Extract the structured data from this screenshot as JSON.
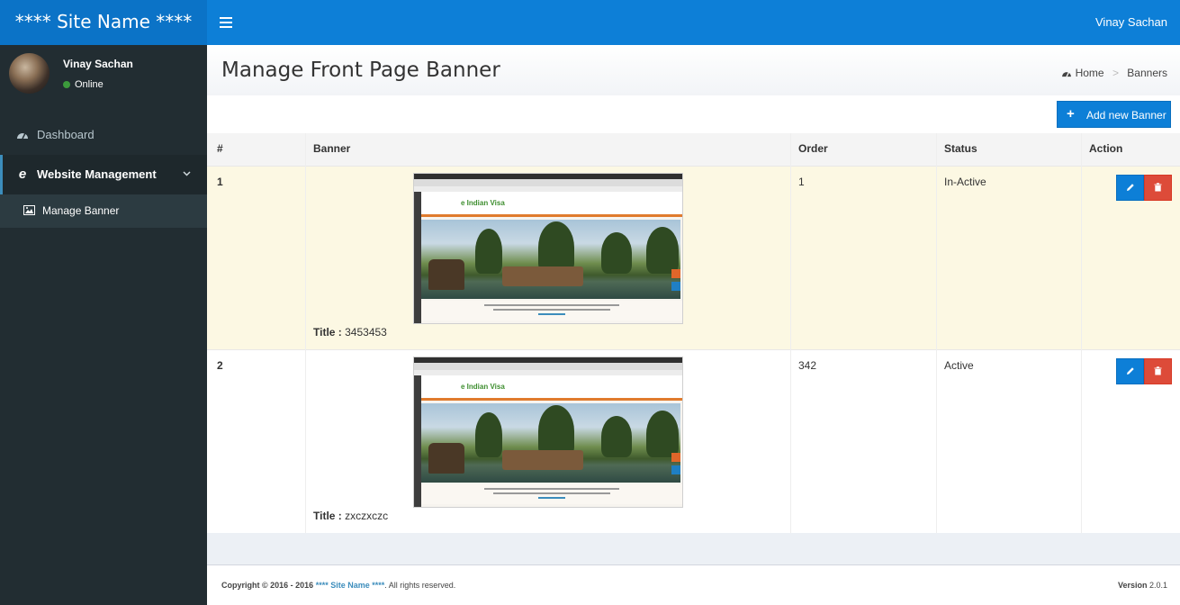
{
  "header": {
    "site_name": "**** Site Name ****",
    "user_name": "Vinay Sachan"
  },
  "sidebar": {
    "user_name": "Vinay Sachan",
    "user_status": "Online",
    "items": [
      {
        "label": "Dashboard",
        "icon": "dashboard-icon"
      },
      {
        "label": "Website Management",
        "icon": "ie-icon"
      },
      {
        "label": "Manage Banner",
        "icon": "image-icon"
      }
    ]
  },
  "page": {
    "title": "Manage Front Page Banner",
    "breadcrumb": [
      "Home",
      "Banners"
    ]
  },
  "toolbar": {
    "add_label": "Add new Banner"
  },
  "table": {
    "headers": [
      "#",
      "Banner",
      "Order",
      "Status",
      "Action"
    ],
    "rows": [
      {
        "num": "1",
        "title_label": "Title :",
        "title": "3453453",
        "order": "1",
        "status": "In-Active"
      },
      {
        "num": "2",
        "title_label": "Title :",
        "title": "zxczxczc",
        "order": "342",
        "status": "Active"
      }
    ]
  },
  "footer": {
    "copyright_prefix": "Copyright © 2016 - 2016",
    "site_name": "**** Site Name ****",
    "rights": ". All rights reserved.",
    "version_label": "Version",
    "version": "2.0.1"
  },
  "colors": {
    "header": "#0d7fd7",
    "sidebar": "#222d32",
    "highlight_row": "#fcf8e3",
    "danger": "#dd4b39"
  }
}
